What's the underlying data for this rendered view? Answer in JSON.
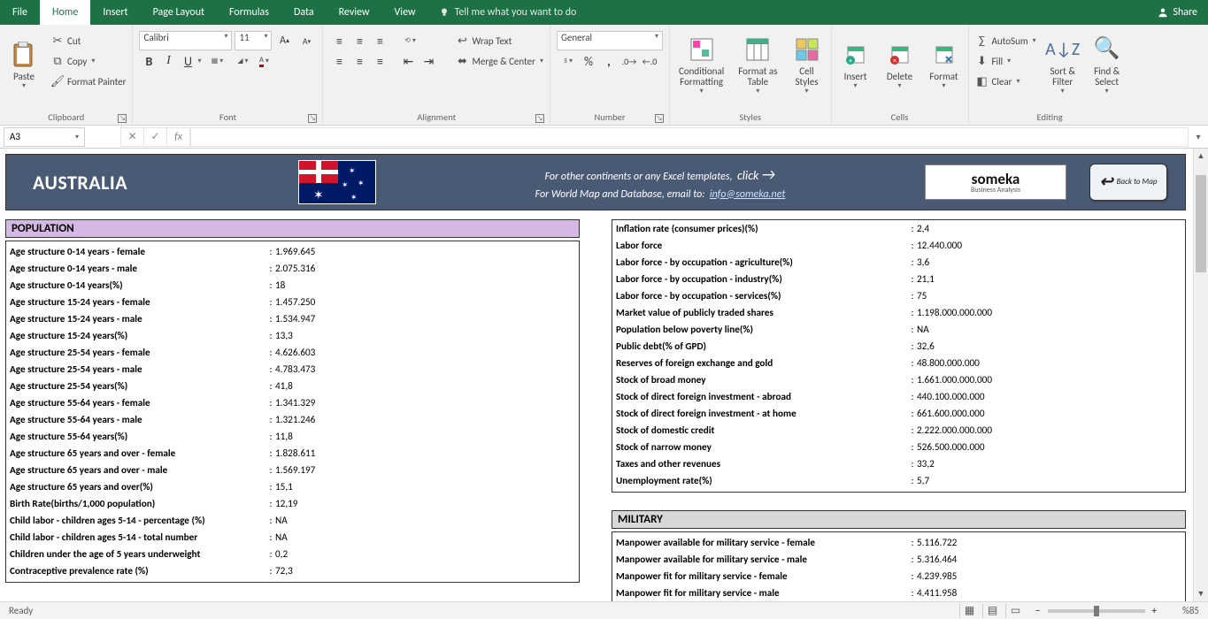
{
  "tabs": {
    "file": "File",
    "home": "Home",
    "insert": "Insert",
    "pagelayout": "Page Layout",
    "formulas": "Formulas",
    "data": "Data",
    "review": "Review",
    "view": "View",
    "tell": "Tell me what you want to do",
    "share": "Share"
  },
  "ribbon": {
    "clipboard": {
      "paste": "Paste",
      "cut": "Cut",
      "copy": "Copy",
      "format_painter": "Format Painter",
      "label": "Clipboard"
    },
    "font": {
      "name": "Calibri",
      "size": "11",
      "label": "Font"
    },
    "alignment": {
      "wrap": "Wrap Text",
      "merge": "Merge & Center",
      "label": "Alignment"
    },
    "number": {
      "format": "General",
      "label": "Number"
    },
    "styles": {
      "cond": "Conditional\nFormatting",
      "table": "Format as\nTable",
      "cell": "Cell\nStyles",
      "label": "Styles"
    },
    "cells": {
      "insert": "Insert",
      "delete": "Delete",
      "format": "Format",
      "label": "Cells"
    },
    "editing": {
      "autosum": "AutoSum",
      "fill": "Fill",
      "clear": "Clear",
      "sort": "Sort &\nFilter",
      "find": "Find &\nSelect",
      "label": "Editing"
    }
  },
  "fbar": {
    "cell": "A3"
  },
  "banner": {
    "country": "AUSTRALIA",
    "line1": "For other continents or any Excel templates,",
    "click": "click",
    "line2": "For World Map and Database, email to:",
    "email": "info@someka.net",
    "logo": "someka",
    "logo_sub": "Business Analysis",
    "back": "Back to Map"
  },
  "population": {
    "header": "POPULATION",
    "rows": [
      {
        "k": "Age structure 0-14 years - female",
        "v": "1.969.645"
      },
      {
        "k": "Age structure 0-14 years - male",
        "v": "2.075.316"
      },
      {
        "k": "Age structure 0-14 years(%)",
        "v": "18"
      },
      {
        "k": "Age structure 15-24 years - female",
        "v": "1.457.250"
      },
      {
        "k": "Age structure 15-24 years - male",
        "v": "1.534.947"
      },
      {
        "k": "Age structure 15-24 years(%)",
        "v": "13,3"
      },
      {
        "k": "Age structure 25-54 years - female",
        "v": "4.626.603"
      },
      {
        "k": "Age structure 25-54 years - male",
        "v": "4.783.473"
      },
      {
        "k": "Age structure 25-54 years(%)",
        "v": "41,8"
      },
      {
        "k": "Age structure 55-64 years - female",
        "v": "1.341.329"
      },
      {
        "k": "Age structure 55-64 years - male",
        "v": "1.321.246"
      },
      {
        "k": "Age structure 55-64 years(%)",
        "v": "11,8"
      },
      {
        "k": "Age structure 65 years and over - female",
        "v": "1.828.611"
      },
      {
        "k": "Age structure 65 years and over - male",
        "v": "1.569.197"
      },
      {
        "k": "Age structure 65 years and over(%)",
        "v": "15,1"
      },
      {
        "k": "Birth Rate(births/1,000 population)",
        "v": "12,19"
      },
      {
        "k": "Child labor - children ages 5-14 - percentage (%)",
        "v": "NA"
      },
      {
        "k": "Child labor - children ages 5-14 - total number",
        "v": "NA"
      },
      {
        "k": "Children under the age of 5 years underweight",
        "v": "0,2"
      },
      {
        "k": "Contraceptive prevalence rate (%)",
        "v": "72,3"
      }
    ]
  },
  "economy": {
    "rows": [
      {
        "k": "Inflation rate (consumer prices)(%)",
        "v": "2,4"
      },
      {
        "k": "Labor force",
        "v": "12.440.000"
      },
      {
        "k": "Labor force - by occupation - agriculture(%)",
        "v": "3,6"
      },
      {
        "k": "Labor force - by occupation - industry(%)",
        "v": "21,1"
      },
      {
        "k": "Labor force - by occupation - services(%)",
        "v": "75"
      },
      {
        "k": "Market value of publicly traded shares",
        "v": "1.198.000.000.000"
      },
      {
        "k": "Population below poverty line(%)",
        "v": "NA"
      },
      {
        "k": "Public debt(% of GPD)",
        "v": "32,6"
      },
      {
        "k": "Reserves of foreign exchange and gold",
        "v": "48.800.000.000"
      },
      {
        "k": "Stock of broad money",
        "v": "1.661.000.000.000"
      },
      {
        "k": "Stock of direct foreign investment - abroad",
        "v": "440.100.000.000"
      },
      {
        "k": "Stock of direct foreign investment - at home",
        "v": "661.600.000.000"
      },
      {
        "k": "Stock of domestic credit",
        "v": "2.222.000.000.000"
      },
      {
        "k": "Stock of narrow money",
        "v": "526.500.000.000"
      },
      {
        "k": "Taxes and other revenues",
        "v": "33,2"
      },
      {
        "k": "Unemployment rate(%)",
        "v": "5,7"
      }
    ]
  },
  "military": {
    "header": "MILITARY",
    "rows": [
      {
        "k": "Manpower available for military service - female",
        "v": "5.116.722"
      },
      {
        "k": "Manpower available for military service - male",
        "v": "5.316.464"
      },
      {
        "k": "Manpower fit for military service - female",
        "v": "4.239.985"
      },
      {
        "k": "Manpower fit for military service - male",
        "v": "4.411.958"
      }
    ]
  },
  "status": {
    "ready": "Ready",
    "zoom": "%85"
  }
}
